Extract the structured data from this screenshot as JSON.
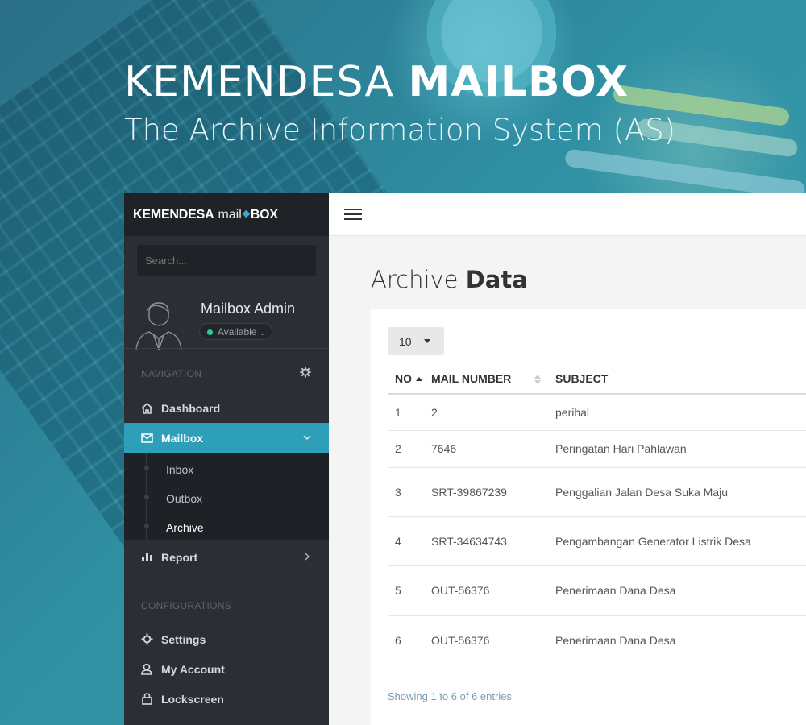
{
  "hero": {
    "title_regular": "KEMENDESA",
    "title_bold": "MAILBOX",
    "subtitle": "The Archive Information System (AS)"
  },
  "sidebar": {
    "brand": {
      "bold": "KEMENDESA",
      "mail": "mail",
      "box": "BOX"
    },
    "search_placeholder": "Search...",
    "user": {
      "name": "Mailbox Admin",
      "status": "Available"
    },
    "sections": {
      "navigation": "NAVIGATION",
      "configurations": "CONFIGURATIONS"
    },
    "nav": [
      {
        "label": "Dashboard",
        "icon": "home-icon"
      },
      {
        "label": "Mailbox",
        "icon": "envelope-icon",
        "active": true
      },
      {
        "label": "Report",
        "icon": "bar-chart-icon"
      }
    ],
    "mailbox_sub": [
      "Inbox",
      "Outbox",
      "Archive"
    ],
    "config": [
      {
        "label": "Settings",
        "icon": "gear-icon"
      },
      {
        "label": "My Account",
        "icon": "user-icon"
      },
      {
        "label": "Lockscreen",
        "icon": "lock-icon"
      }
    ]
  },
  "main": {
    "title_regular": "Archive",
    "title_bold": "Data",
    "page_length": "10",
    "columns": [
      "NO",
      "MAIL NUMBER",
      "SUBJECT"
    ],
    "rows": [
      {
        "no": "1",
        "mail_number": "2",
        "subject": "perihal"
      },
      {
        "no": "2",
        "mail_number": "7646",
        "subject": "Peringatan Hari Pahlawan"
      },
      {
        "no": "3",
        "mail_number": "SRT-39867239",
        "subject": "Penggalian Jalan Desa Suka Maju"
      },
      {
        "no": "4",
        "mail_number": "SRT-34634743",
        "subject": "Pengambangan Generator Listrik Desa"
      },
      {
        "no": "5",
        "mail_number": "OUT-56376",
        "subject": "Penerimaan Dana Desa"
      },
      {
        "no": "6",
        "mail_number": "OUT-56376",
        "subject": "Penerimaan Dana Desa"
      }
    ],
    "footer": "Showing 1 to 6 of 6 entries"
  },
  "colors": {
    "accent": "#2e9fb8",
    "sidebar_bg": "#2b2f35",
    "status_online": "#2ecc8f"
  }
}
